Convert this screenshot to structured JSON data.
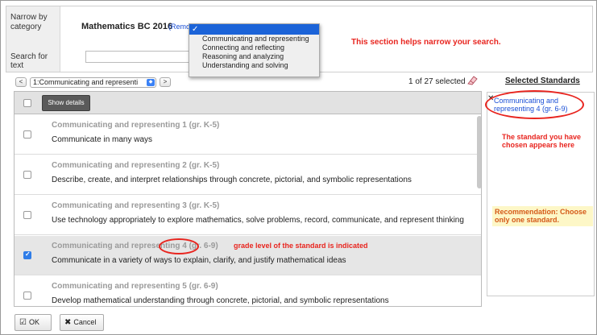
{
  "filter": {
    "narrow_label": "Narrow by category",
    "search_label": "Search for text",
    "course_title": "Mathematics BC 2016",
    "remove_link": "(Remov",
    "search_value": "",
    "note": "This section helps narrow your search."
  },
  "dropdown": {
    "selected_glyph": "✓",
    "items": [
      "Communicating and representing",
      "Connecting and reflecting",
      "Reasoning and analyzing",
      "Understanding and solving"
    ]
  },
  "toolbar": {
    "prev_label": "<",
    "next_label": ">",
    "select_value": "1:Communicating and representi",
    "count": "1 of 27 selected",
    "selected_title": "Selected Standards"
  },
  "list": {
    "show_details_label": "Show details",
    "rows": [
      {
        "title": "Communicating and representing 1 (gr. K-5)",
        "desc": "Communicate in many ways",
        "checked": false
      },
      {
        "title": "Communicating and representing 2 (gr. K-5)",
        "desc": "Describe, create, and interpret relationships through concrete, pictorial, and symbolic representations",
        "checked": false
      },
      {
        "title": "Communicating and representing 3 (gr. K-5)",
        "desc": "Use technology appropriately to explore mathematics, solve problems, record, communicate, and represent thinking",
        "checked": false
      },
      {
        "title": "Communicating and representing 4 (gr. 6-9)",
        "desc": "Communicate in a variety of ways to explain, clarify, and justify mathematical ideas",
        "checked": true,
        "note": "grade level of the standard is indicated"
      },
      {
        "title": "Communicating and representing 5 (gr. 6-9)",
        "desc": "Develop mathematical understanding through concrete, pictorial, and symbolic representations",
        "checked": false
      }
    ]
  },
  "right_panel": {
    "chip_x": "✕",
    "chip_text": "Communicating and representing 4 (gr. 6-9)",
    "note": "The standard you have chosen appears here",
    "recommendation": "Recommendation: Choose only one standard."
  },
  "footer": {
    "ok_label": "OK",
    "cancel_label": "Cancel"
  },
  "colors": {
    "annotation": "#e8251f",
    "link": "#1a4fd6",
    "dropdown_highlight": "#1b63d8"
  }
}
